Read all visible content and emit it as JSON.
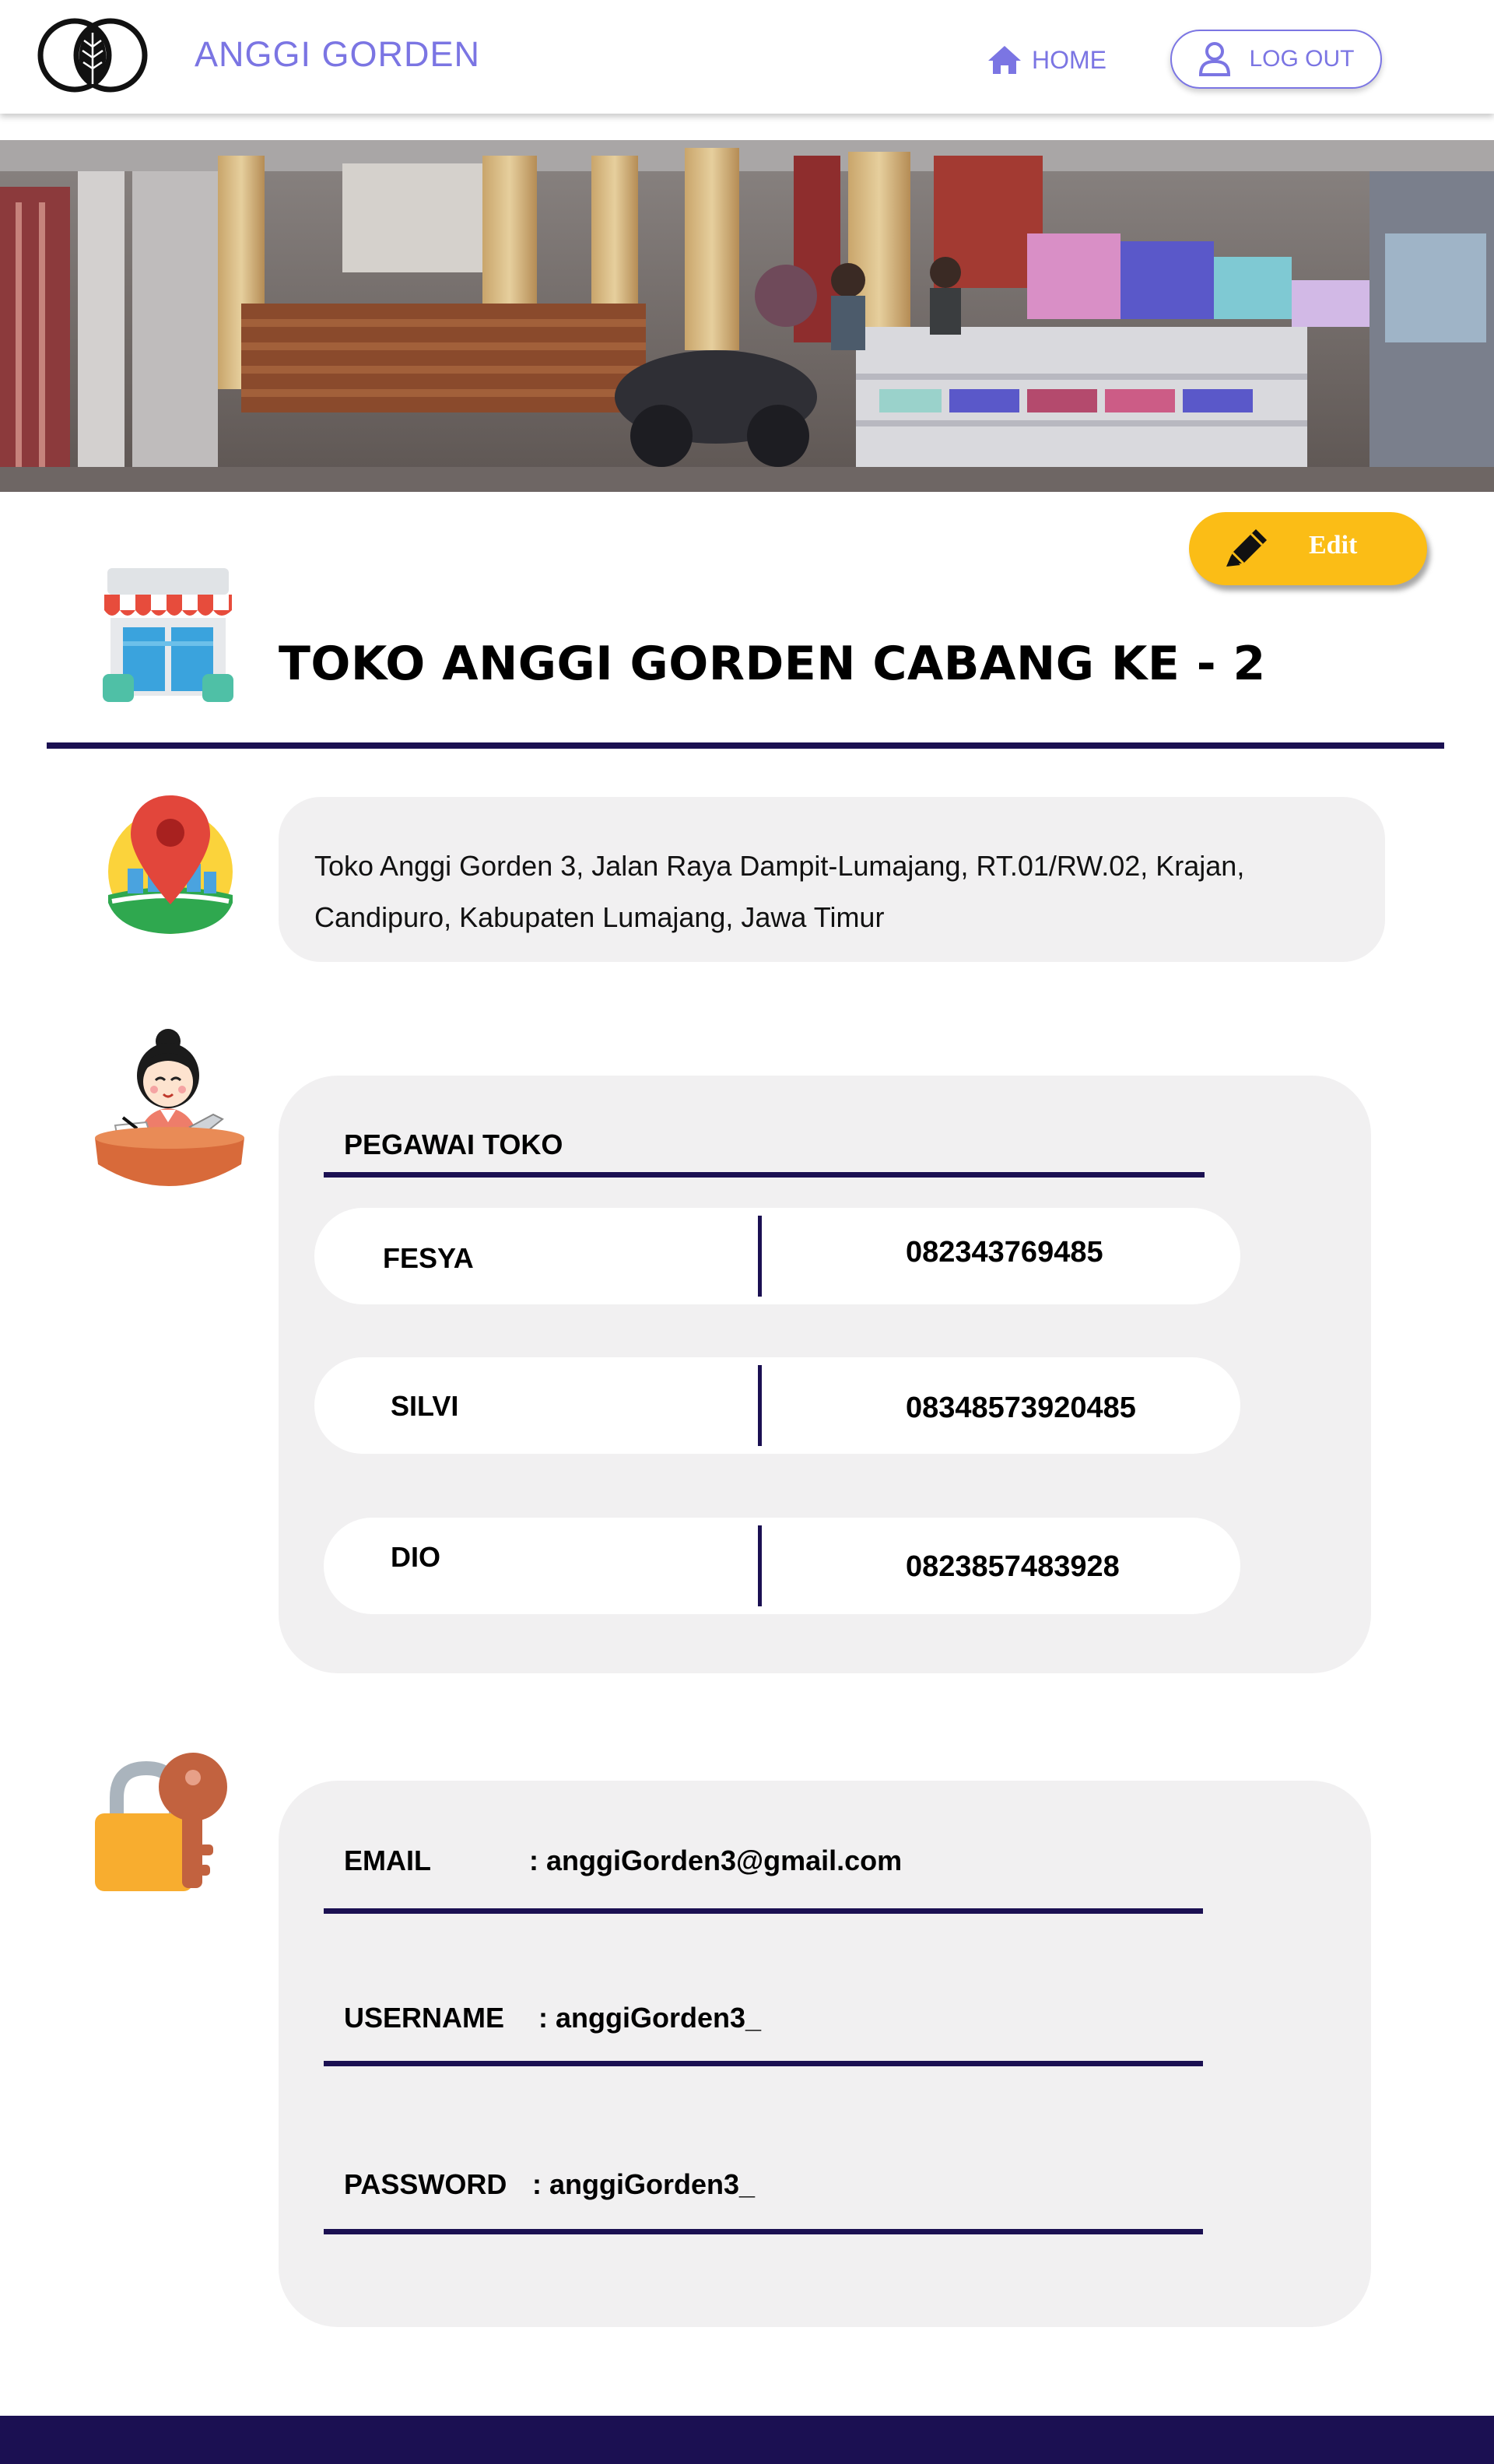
{
  "navbar": {
    "brand": "ANGGI GORDEN",
    "home_label": "HOME",
    "logout_label": "LOG OUT",
    "accent_color": "#7b75e3"
  },
  "banner": {
    "alt": "store front photo"
  },
  "edit_button": {
    "label": "Edit",
    "color": "#fbbd16"
  },
  "store": {
    "title": "TOKO ANGGI GORDEN CABANG KE - 2",
    "address": "Toko Anggi Gorden 3, Jalan Raya Dampit-Lumajang, RT.01/RW.02, Krajan, Candipuro, Kabupaten Lumajang, Jawa Timur"
  },
  "employees": {
    "heading": "PEGAWAI TOKO",
    "rows": [
      {
        "name": "FESYA",
        "phone": "082343769485"
      },
      {
        "name": "SILVI",
        "phone": "08348573920485"
      },
      {
        "name": "DIO",
        "phone": "0823857483928"
      }
    ]
  },
  "credentials": {
    "email_label": "EMAIL",
    "email_value": ": anggiGorden3@gmail.com",
    "username_label": "USERNAME",
    "username_value": ": anggiGorden3_",
    "password_label": "PASSWORD",
    "password_value": ": anggiGorden3_"
  },
  "theme": {
    "rule_color": "#1b1052",
    "card_bg": "#f1f0f1"
  },
  "icons": [
    "leaf-logo-icon",
    "home-icon",
    "user-icon",
    "pencil-icon",
    "store-icon",
    "map-pin-icon",
    "shopkeeper-icon",
    "lock-key-icon"
  ]
}
